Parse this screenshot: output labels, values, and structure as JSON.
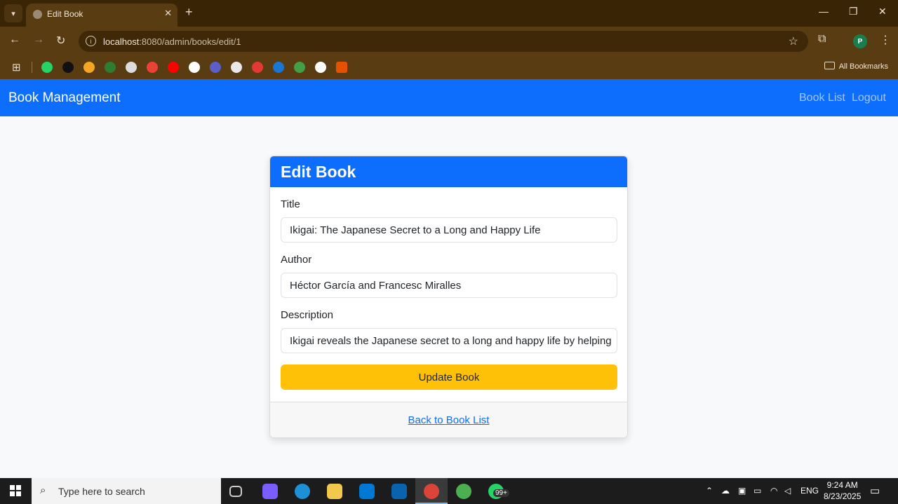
{
  "browser": {
    "tab_title": "Edit Book",
    "url_host": "localhost",
    "url_rest": ":8080/admin/books/edit/1",
    "all_bookmarks": "All Bookmarks",
    "profile_initial": "P",
    "bookmark_colors": [
      "#25d366",
      "#111111",
      "#f5a623",
      "#2e7d32",
      "#dddddd",
      "#ea4335",
      "#ff0000",
      "#ffffff",
      "#5b5fc7",
      "#e8e8e8",
      "#e53935",
      "#1976d2",
      "#43a047",
      "#ffffff",
      "#e65100"
    ]
  },
  "navbar": {
    "brand": "Book Management",
    "links": [
      "Book List",
      "Logout"
    ]
  },
  "card": {
    "header": "Edit Book",
    "fields": [
      {
        "label": "Title",
        "value": "Ikigai: The Japanese Secret to a Long and Happy Life"
      },
      {
        "label": "Author",
        "value": "Héctor García and Francesc Miralles"
      },
      {
        "label": "Description",
        "value": "Ikigai reveals the Japanese secret to a long and happy life by helping"
      }
    ],
    "submit": "Update Book",
    "back_link": "Back to Book List"
  },
  "taskbar": {
    "search_placeholder": "Type here to search",
    "badge": "99+",
    "language": "ENG",
    "time": "9:24 AM",
    "date": "8/23/2025",
    "pinned_colors": [
      "#cccccc",
      "#7b5cff",
      "#1e90d6",
      "#f2c94c",
      "#0078d4",
      "#0a64ad",
      "#db4437",
      "#4caf50",
      "#25d366"
    ]
  },
  "colors": {
    "primary": "#0d6efd",
    "warning": "#ffc107"
  }
}
